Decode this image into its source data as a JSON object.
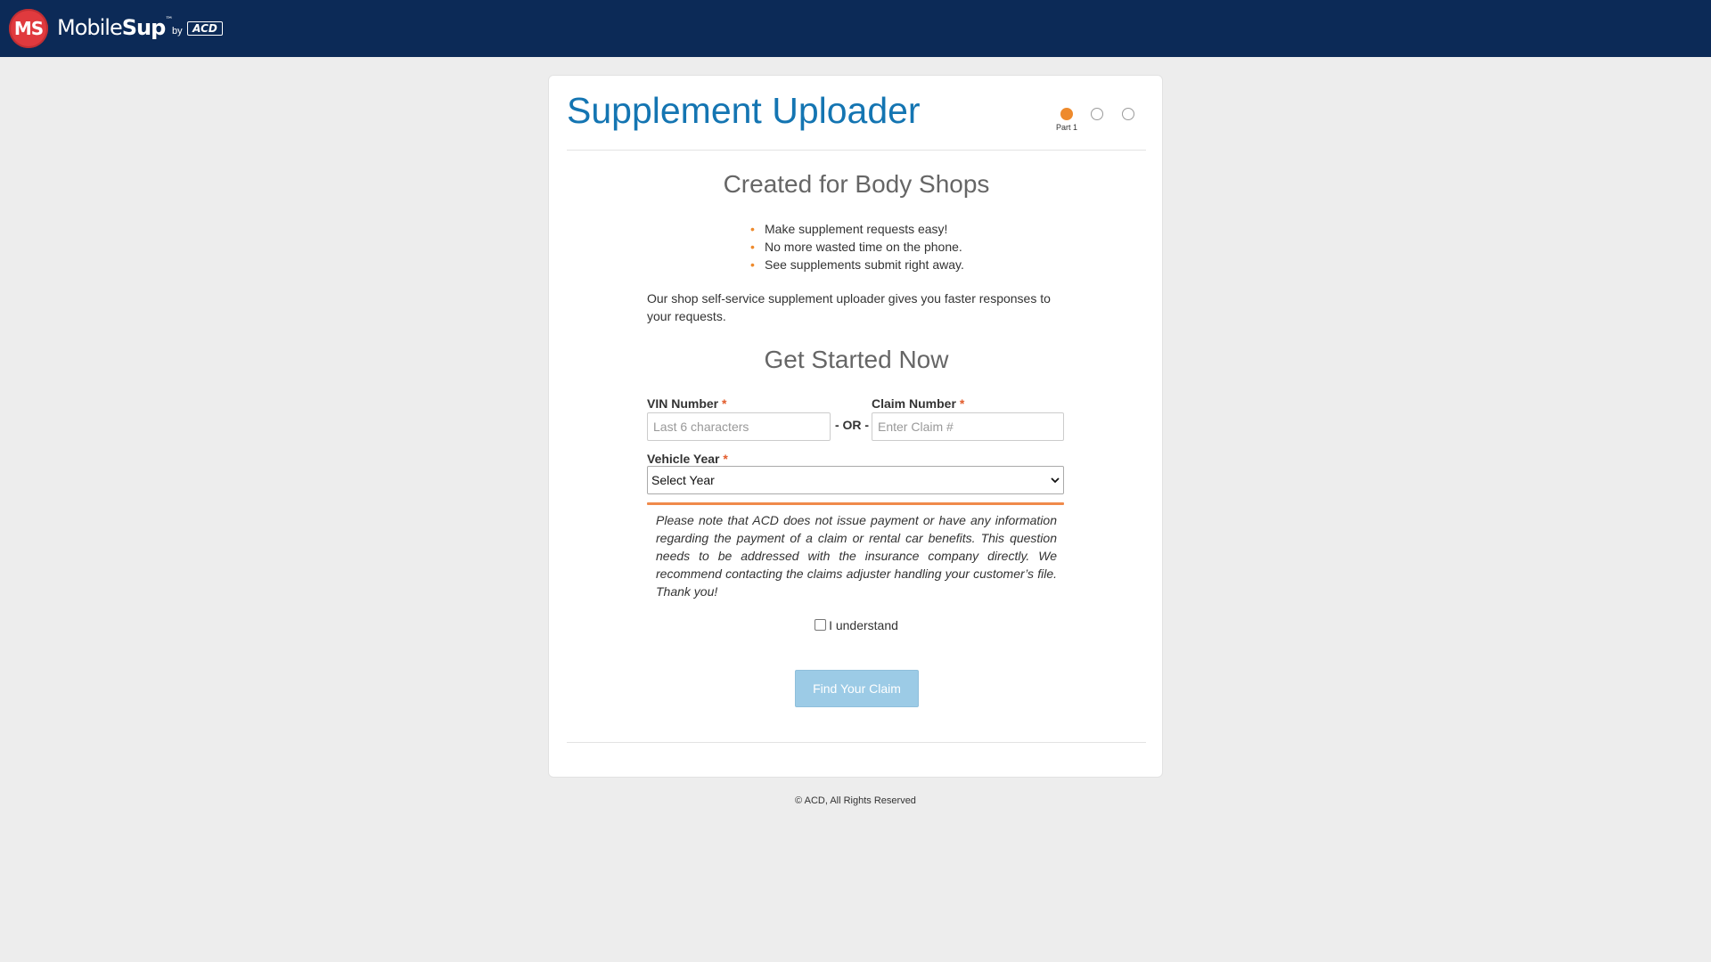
{
  "header": {
    "logo_badge": "MS",
    "logo_word_main": "Mobile",
    "logo_word_bold": "Sup",
    "logo_tm": "™",
    "by": "by",
    "partner": "ACD",
    "bg_color": "#0c2a57"
  },
  "card": {
    "title": "Supplement Uploader",
    "steps": {
      "current_label": "Part 1",
      "total": 3,
      "current": 1,
      "active_color": "#ee8a2c"
    },
    "created_heading": "Created for Body Shops",
    "bullets": [
      "Make supplement requests easy!",
      "No more wasted time on the phone.",
      "See supplements submit right away."
    ],
    "intro": "Our shop self-service supplement uploader gives you faster responses to your requests.",
    "started_heading": "Get Started Now",
    "form": {
      "vin_label": "VIN Number",
      "vin_placeholder": "Last 6 characters",
      "vin_value": "",
      "or_text": "- OR -",
      "claim_label": "Claim Number",
      "claim_placeholder": "Enter Claim #",
      "claim_value": "",
      "required_mark": "*",
      "year_label": "Vehicle Year",
      "year_selected": "Select Year"
    },
    "notice": "Please note that ACD does not issue payment or have any information regarding the payment of a claim or rental car benefits. This question needs to be addressed with the insurance company directly. We recommend contacting the claims adjuster handling your customer’s file. Thank you!",
    "acknowledge_label": "I understand",
    "acknowledge_checked": false,
    "button_label": "Find Your Claim"
  },
  "footer": {
    "copyright": "© ACD, All Rights Reserved"
  }
}
